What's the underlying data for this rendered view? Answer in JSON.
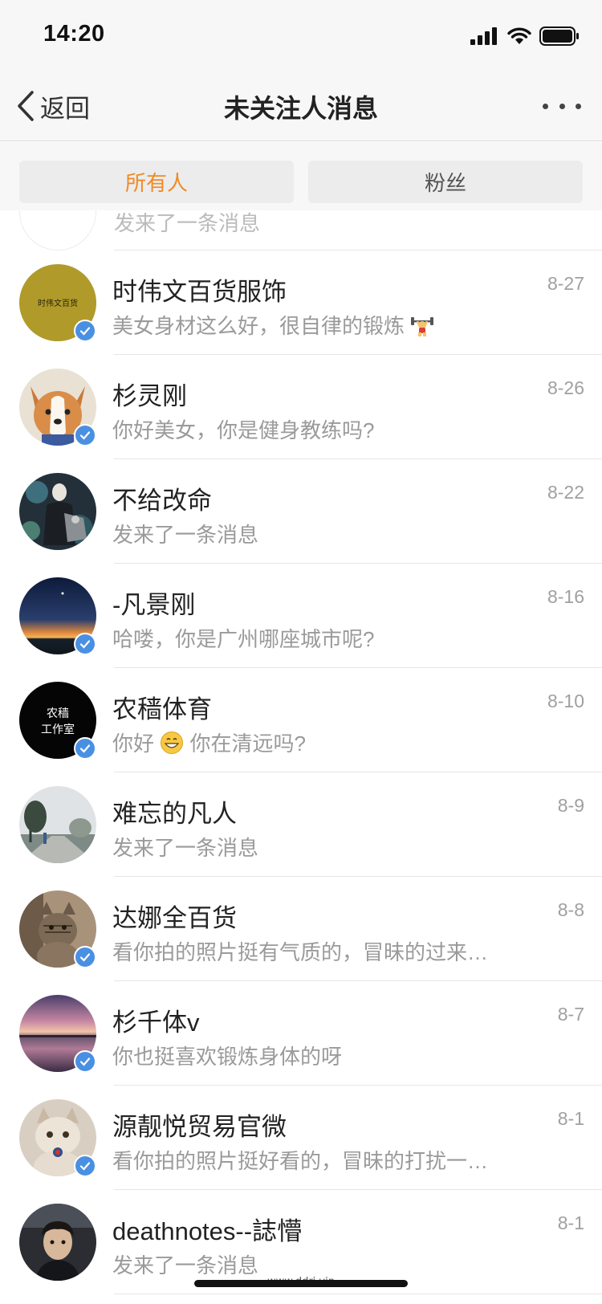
{
  "status_bar": {
    "time": "14:20",
    "icons": [
      "signal-icon",
      "wifi-icon",
      "battery-icon"
    ]
  },
  "nav": {
    "back_label": "返回",
    "title": "未关注人消息",
    "more_icon": "more-dots-icon"
  },
  "tabs": [
    {
      "label": "所有人",
      "active": true,
      "color": "#f08a24"
    },
    {
      "label": "粉丝",
      "active": false,
      "color": "#555555"
    }
  ],
  "partial_row": {
    "text": "发来了一条消息"
  },
  "conversations": [
    {
      "name": "时伟文百货服饰",
      "message": "美女身材这么好，很自律的锻炼",
      "date": "8-27",
      "avatar_text": "时伟文百货",
      "verified": true
    },
    {
      "name": "杉灵刚",
      "message": "你好美女，你是健身教练吗?",
      "date": "8-26",
      "verified": true
    },
    {
      "name": "不给改命",
      "message": "发来了一条消息",
      "date": "8-22",
      "verified": false
    },
    {
      "name": "-凡景刚",
      "message": "哈喽，你是广州哪座城市呢?",
      "date": "8-16",
      "verified": true
    },
    {
      "name": "农穑体育",
      "message_before": "你好",
      "message_after": "你在清远吗?",
      "date": "8-10",
      "avatar_text_1": "农穑",
      "avatar_text_2": "工作室",
      "verified": true
    },
    {
      "name": "难忘的凡人",
      "message": "发来了一条消息",
      "date": "8-9",
      "verified": false
    },
    {
      "name": "达娜全百货",
      "message": "看你拍的照片挺有气质的，冒昧的过来…",
      "date": "8-8",
      "verified": true
    },
    {
      "name": "杉千体v",
      "message": "你也挺喜欢锻炼身体的呀",
      "date": "8-7",
      "verified": true
    },
    {
      "name": "源靓悦贸易官微",
      "message": "看你拍的照片挺好看的，冒昧的打扰一…",
      "date": "8-1",
      "verified": true
    },
    {
      "name": "deathnotes--誌懵",
      "message": "发来了一条消息",
      "date": "8-1",
      "verified": false
    }
  ],
  "watermark": "www.ddrj.vip"
}
